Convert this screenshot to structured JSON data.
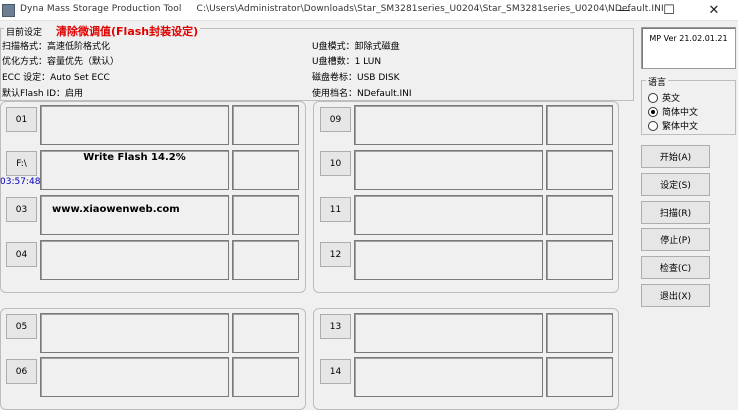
{
  "titlebar": {
    "app_title": "Dyna Mass Storage Production Tool",
    "path": "C:\\Users\\Administrator\\Downloads\\Star_SM3281series_U0204\\Star_SM3281series_U0204\\NDefault.INI",
    "minimize": "—",
    "maximize": "☐",
    "close": "✕"
  },
  "settings": {
    "legend": "目前设定",
    "notice": "清除微调值(Flash封装设定)",
    "scan_format": "扫描格式：高速低阶格式化",
    "optimize": "优化方式：容量优先（默认）",
    "ecc": "ECC 设定：Auto Set ECC",
    "flash_id": "默认Flash ID：启用",
    "disk_mode": "U盘模式：卸除式磁盘",
    "disk_count": "U盘槽数：1 LUN",
    "disk_label": "磁盘卷标：USB DISK",
    "ini_file": "使用档名：NDefault.INI"
  },
  "version": "MP Ver 21.02.01.21",
  "language": {
    "legend": "语言",
    "options": [
      "英文",
      "简体中文",
      "繁体中文"
    ],
    "selected": "简体中文"
  },
  "actions": {
    "start": "开始(A)",
    "settings": "设定(S)",
    "scan": "扫描(R)",
    "stop": "停止(P)",
    "check": "检查(C)",
    "exit": "退出(X)"
  },
  "ports": {
    "p01": "01",
    "p02": "F:\\",
    "p03": "03",
    "p04": "04",
    "p05": "05",
    "p06": "06",
    "p09": "09",
    "p10": "10",
    "p11": "11",
    "p12": "12",
    "p13": "13",
    "p14": "14"
  },
  "status": {
    "write_flash": "Write Flash 14.2%",
    "timer": "03:57:48",
    "website": "www.xiaowenweb.com"
  }
}
